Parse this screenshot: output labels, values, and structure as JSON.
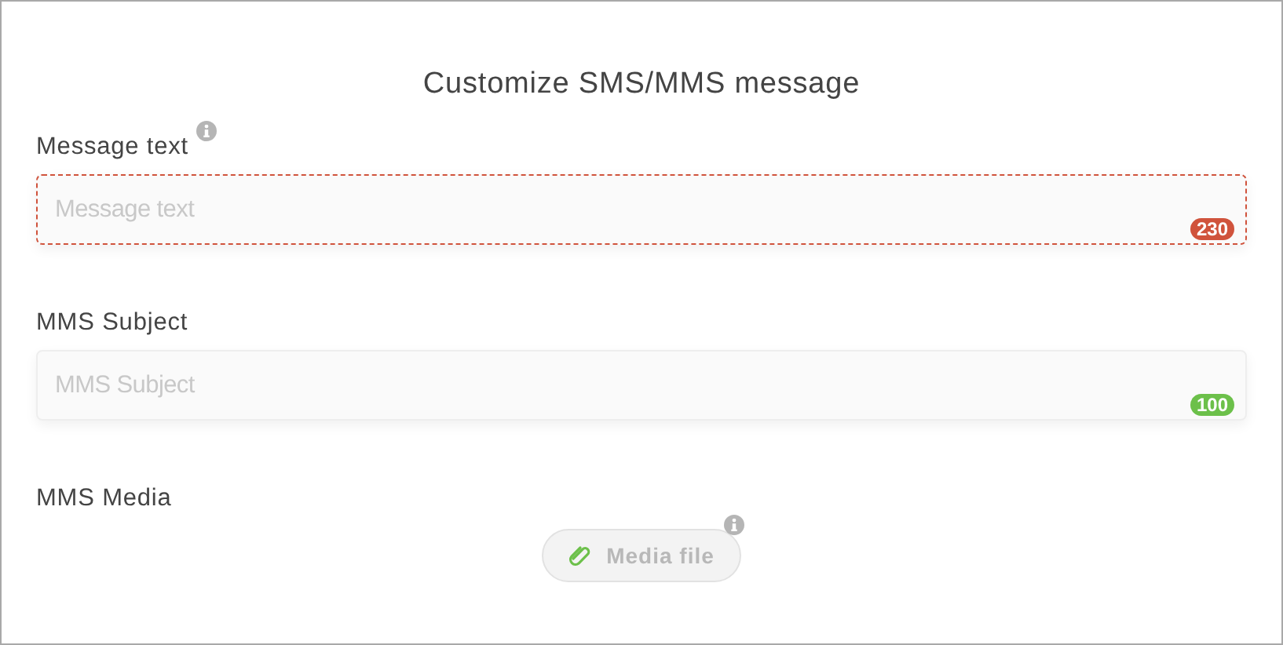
{
  "title": "Customize SMS/MMS message",
  "fields": [
    {
      "label": "Message text",
      "info": true,
      "placeholder": "Message text",
      "invalid": true,
      "counter": "230",
      "color": "#d0533c"
    },
    {
      "label": "MMS Subject",
      "info": false,
      "placeholder": "MMS Subject",
      "invalid": false,
      "counter": "100",
      "color": "#6cc04a"
    }
  ],
  "media": {
    "label": "MMS Media",
    "button": "Media file",
    "info": true
  }
}
